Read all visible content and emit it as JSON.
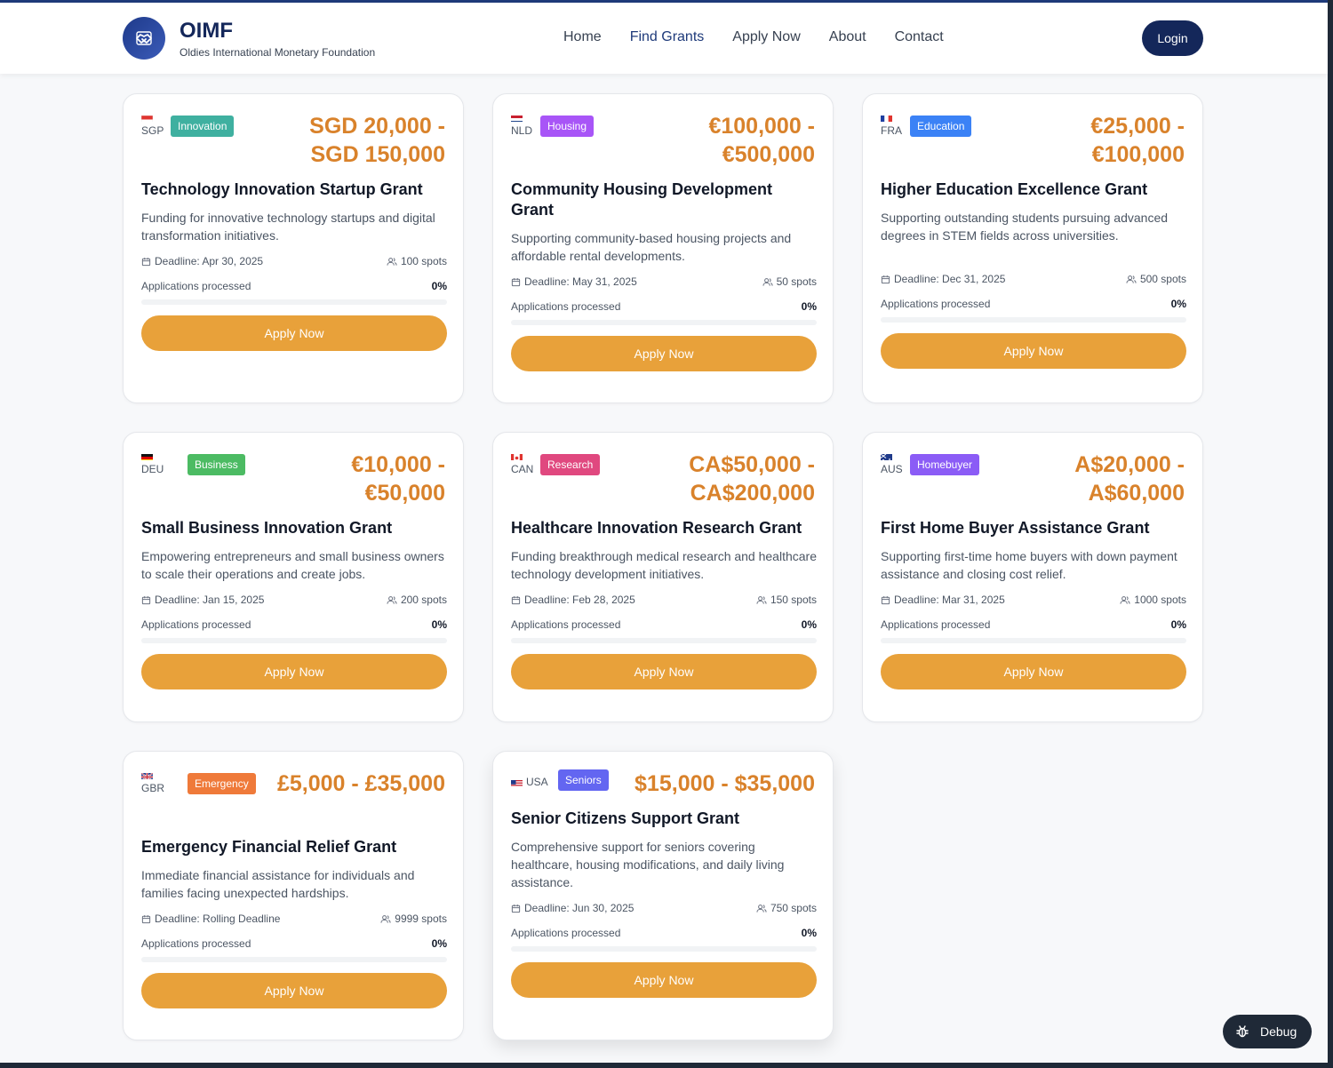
{
  "header": {
    "brand_name": "OIMF",
    "brand_sub": "Oldies International Monetary Foundation",
    "nav": [
      "Home",
      "Find Grants",
      "Apply Now",
      "About",
      "Contact"
    ],
    "active_nav": "Find Grants",
    "login_label": "Login"
  },
  "labels": {
    "apply": "Apply Now",
    "processed": "Applications processed"
  },
  "grants": [
    {
      "country": "SGP",
      "flag": "sg-flag-icon",
      "category": "Innovation",
      "category_color": "#3fb0a0",
      "amount": "SGD 20,000 - SGD 150,000",
      "title": "Technology Innovation Startup Grant",
      "description": "Funding for innovative technology startups and digital transformation initiatives.",
      "deadline": "Deadline: Apr 30, 2025",
      "spots": "100 spots",
      "progress": "0%"
    },
    {
      "country": "NLD",
      "flag": "nl-flag-icon",
      "category": "Housing",
      "category_color": "#a855f7",
      "amount": "€100,000 - €500,000",
      "title": "Community Housing Development Grant",
      "description": "Supporting community-based housing projects and affordable rental developments.",
      "deadline": "Deadline: May 31, 2025",
      "spots": "50 spots",
      "progress": "0%"
    },
    {
      "country": "FRA",
      "flag": "fr-flag-icon",
      "category": "Education",
      "category_color": "#3b82f6",
      "amount": "€25,000 - €100,000",
      "title": "Higher Education Excellence Grant",
      "description": "Supporting outstanding students pursuing advanced degrees in STEM fields across universities.",
      "deadline": "Deadline: Dec 31, 2025",
      "spots": "500 spots",
      "progress": "0%"
    },
    {
      "country": "DEU",
      "flag": "de-flag-icon",
      "category": "Business",
      "category_color": "#4cbb63",
      "amount": "€10,000 - €50,000",
      "title": "Small Business Innovation Grant",
      "description": "Empowering entrepreneurs and small business owners to scale their operations and create jobs.",
      "deadline": "Deadline: Jan 15, 2025",
      "spots": "200 spots",
      "progress": "0%"
    },
    {
      "country": "CAN",
      "flag": "ca-flag-icon",
      "category": "Research",
      "category_color": "#e0487f",
      "amount": "CA$50,000 - CA$200,000",
      "title": "Healthcare Innovation Research Grant",
      "description": "Funding breakthrough medical research and healthcare technology development initiatives.",
      "deadline": "Deadline: Feb 28, 2025",
      "spots": "150 spots",
      "progress": "0%"
    },
    {
      "country": "AUS",
      "flag": "au-flag-icon",
      "category": "Homebuyer",
      "category_color": "#8b5cf6",
      "amount": "A$20,000 - A$60,000",
      "title": "First Home Buyer Assistance Grant",
      "description": "Supporting first-time home buyers with down payment assistance and closing cost relief.",
      "deadline": "Deadline: Mar 31, 2025",
      "spots": "1000 spots",
      "progress": "0%"
    },
    {
      "country": "GBR",
      "flag": "gb-flag-icon",
      "category": "Emergency",
      "category_color": "#ef7a3a",
      "amount": "£5,000 - £35,000",
      "title": "Emergency Financial Relief Grant",
      "description": "Immediate financial assistance for individuals and families facing unexpected hardships.",
      "deadline": "Deadline: Rolling Deadline",
      "spots": "9999 spots",
      "progress": "0%"
    },
    {
      "country": "USA",
      "flag": "us-flag-icon",
      "category": "Seniors",
      "category_color": "#6366f1",
      "amount": "$15,000 - $35,000",
      "title": "Senior Citizens Support Grant",
      "description": "Comprehensive support for seniors covering healthcare, housing modifications, and daily living assistance.",
      "deadline": "Deadline: Jun 30, 2025",
      "spots": "750 spots",
      "progress": "0%"
    }
  ],
  "debug_label": "Debug",
  "colors": {
    "accent": "#e8a13a",
    "brand": "#14275a",
    "amount": "#d9822b"
  }
}
